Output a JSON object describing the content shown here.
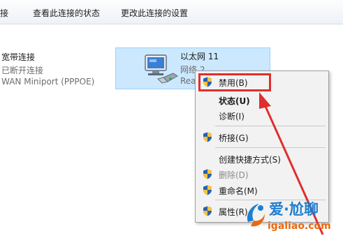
{
  "toolbar": {
    "item0": "连接",
    "item1": "查看此连接的状态",
    "item2": "更改此连接的设置"
  },
  "broadband": {
    "name": "宽带连接",
    "status": "已断开连接",
    "device": "WAN Miniport (PPPOE)"
  },
  "ethernet": {
    "name": "以太网 11",
    "network": "网络 2",
    "status": "Rea"
  },
  "context_menu": {
    "disable": "禁用(B)",
    "status": "状态(U)",
    "diagnose": "诊断(I)",
    "bridge": "桥接(G)",
    "shortcut": "创建快捷方式(S)",
    "delete": "删除(D)",
    "rename": "重命名(M)",
    "properties": "属性(R)"
  },
  "watermark": {
    "title": "爱·尬聊",
    "url": "igaliao.com"
  },
  "colors": {
    "highlight_border": "#e02e2e",
    "selection_bg": "#cce8ff",
    "arrow": "#e02e2e"
  }
}
